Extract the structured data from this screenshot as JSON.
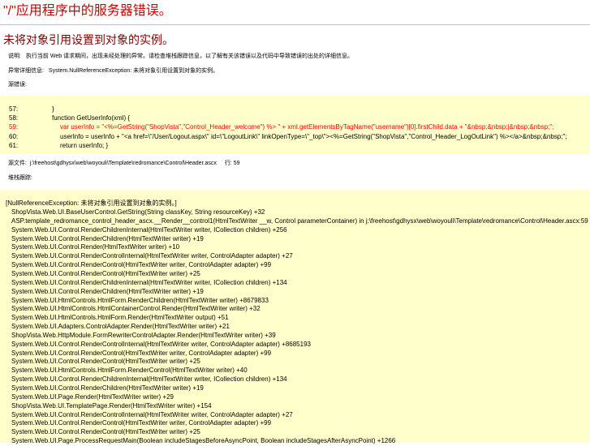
{
  "page": {
    "title": "\"/\"应用程序中的服务器错误。",
    "subtitle": "未将对象引用设置到对象的实例。"
  },
  "description": {
    "label": "说明:",
    "text": "执行当前 Web 请求期间，出现未经处理的异常。请检查堆栈跟踪信息，以了解有关该错误以及代码中导致错误的出处的详细信息。"
  },
  "exception": {
    "label": "异常详细信息:",
    "text": "System.NullReferenceException: 未将对象引用设置到对象的实例。"
  },
  "source_error": {
    "label": "源错误:",
    "lines": [
      {
        "num": "57:",
        "text": "}",
        "indent": 1,
        "error": false
      },
      {
        "num": "58:",
        "text": "function GetUserInfo(xml) {",
        "indent": 1,
        "error": false
      },
      {
        "num": "59:",
        "text": "var userInfo = \"<%=GetString(\"ShopVista\",\"Control_Header_welcome\") %> \" + xml.getElementsByTagName(\"username\")[0].firstChild.data + \"&nbsp;&nbsp;|&nbsp;&nbsp;\";",
        "indent": 2,
        "error": true
      },
      {
        "num": "60:",
        "text": "userInfo = userInfo + \"<a href=\\\"/User/Logout.aspx\\\" id=\\\"LogoutLink\\\" linkOpenType=\\\"_top\\\"><%=GetString(\"ShopVista\",\"Control_Header_LogOutLink\") %></a>&nbsp;&nbsp;\";",
        "indent": 2,
        "error": false
      },
      {
        "num": "61:",
        "text": "return userInfo; }",
        "indent": 2,
        "error": false
      }
    ]
  },
  "source_file": {
    "label": "源文件:",
    "path": "j:\\freehost\\gdhysx\\web\\woyouli\\Template\\redromance\\Control\\Header.ascx",
    "line_label": "行:",
    "line": "59"
  },
  "stack_trace": {
    "label": "堆栈跟踪:",
    "header": "[NullReferenceException: 未将对象引用设置到对象的实例。]",
    "lines": [
      "ShopVista.Web.UI.BaseUserControl.GetString(String classKey, String resourceKey) +32",
      "ASP.template_redromance_control_header_ascx.__Render__control1(HtmlTextWriter __w, Control parameterContainer) in j:\\freehost\\gdhysx\\web\\woyouli\\Template\\redromance\\Control\\Header.ascx:59",
      "System.Web.UI.Control.RenderChildrenInternal(HtmlTextWriter writer, ICollection children) +256",
      "System.Web.UI.Control.RenderChildren(HtmlTextWriter writer) +19",
      "System.Web.UI.Control.Render(HtmlTextWriter writer) +10",
      "System.Web.UI.Control.RenderControlInternal(HtmlTextWriter writer, ControlAdapter adapter) +27",
      "System.Web.UI.Control.RenderControl(HtmlTextWriter writer, ControlAdapter adapter) +99",
      "System.Web.UI.Control.RenderControl(HtmlTextWriter writer) +25",
      "System.Web.UI.Control.RenderChildrenInternal(HtmlTextWriter writer, ICollection children) +134",
      "System.Web.UI.Control.RenderChildren(HtmlTextWriter writer) +19",
      "System.Web.UI.HtmlControls.HtmlForm.RenderChildren(HtmlTextWriter writer) +8679833",
      "System.Web.UI.HtmlControls.HtmlContainerControl.Render(HtmlTextWriter writer) +32",
      "System.Web.UI.HtmlControls.HtmlForm.Render(HtmlTextWriter output) +51",
      "System.Web.UI.Adapters.ControlAdapter.Render(HtmlTextWriter writer) +21",
      "ShopVista.Web.HttpModule.FormRewriterControlAdapter.Render(HtmlTextWriter writer) +39",
      "System.Web.UI.Control.RenderControlInternal(HtmlTextWriter writer, ControlAdapter adapter) +8685193",
      "System.Web.UI.Control.RenderControl(HtmlTextWriter writer, ControlAdapter adapter) +99",
      "System.Web.UI.Control.RenderControl(HtmlTextWriter writer) +25",
      "System.Web.UI.HtmlControls.HtmlForm.RenderControl(HtmlTextWriter writer) +40",
      "System.Web.UI.Control.RenderChildrenInternal(HtmlTextWriter writer, ICollection children) +134",
      "System.Web.UI.Control.RenderChildren(HtmlTextWriter writer) +19",
      "System.Web.UI.Page.Render(HtmlTextWriter writer) +29",
      "ShopVista.Web.UI.TemplatePage.Render(HtmlTextWriter writer) +154",
      "System.Web.UI.Control.RenderControlInternal(HtmlTextWriter writer, ControlAdapter adapter) +27",
      "System.Web.UI.Control.RenderControl(HtmlTextWriter writer, ControlAdapter adapter) +99",
      "System.Web.UI.Control.RenderControl(HtmlTextWriter writer) +25",
      "System.Web.UI.Page.ProcessRequestMain(Boolean includeStagesBeforeAsyncPoint, Boolean includeStagesAfterAsyncPoint) +1266"
    ]
  },
  "colors": {
    "title": "#cc0000",
    "subtitle": "#800000",
    "code_background": "#ffffcc",
    "error_line": "#ff0000"
  }
}
